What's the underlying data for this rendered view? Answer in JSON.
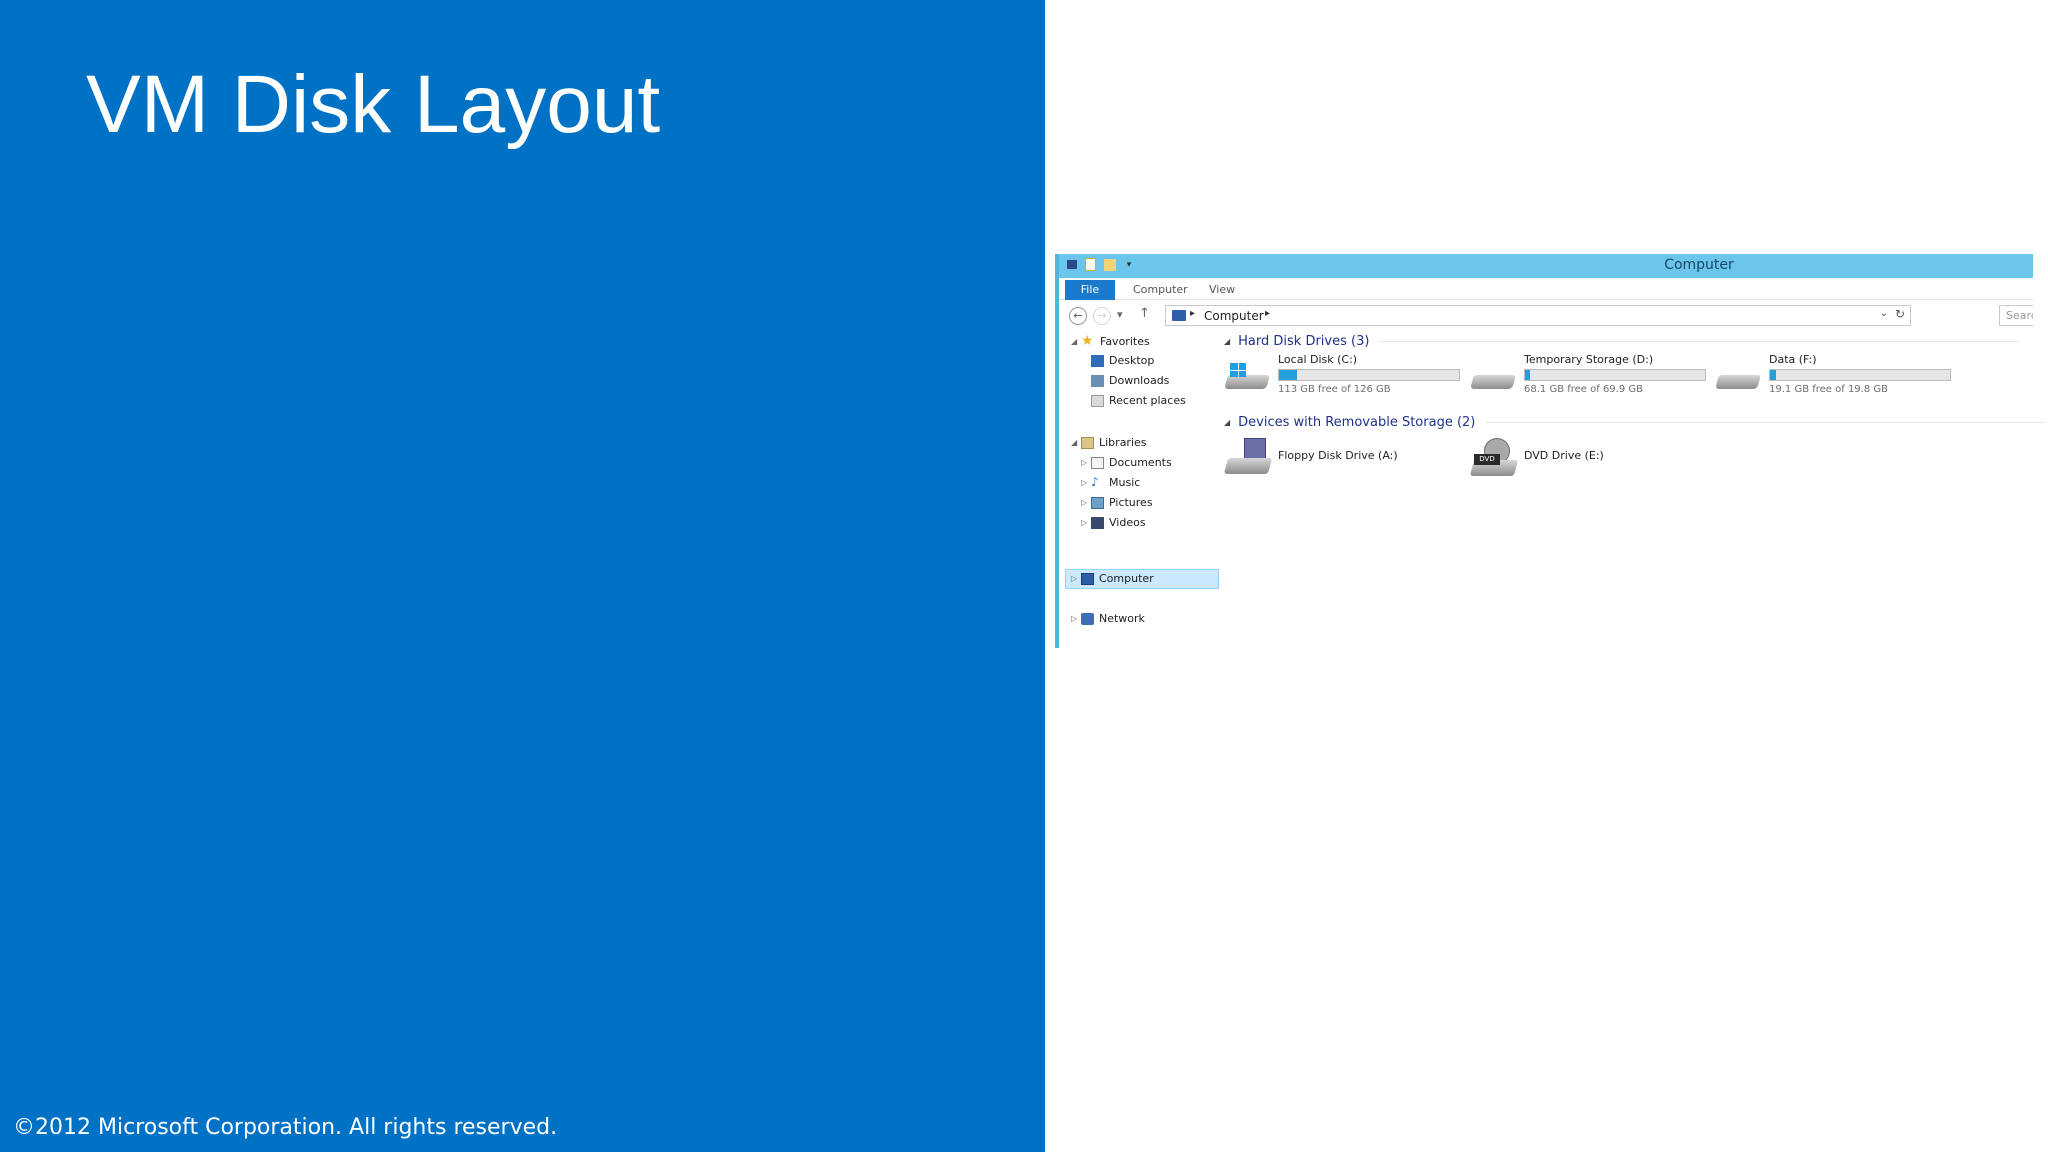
{
  "slide": {
    "title": "VM Disk Layout",
    "copyright": "©2012 Microsoft Corporation. All rights reserved.",
    "background_color": "#0072c6"
  },
  "window": {
    "title": "Computer",
    "title_bar_color": "#6cc5ea",
    "tabs": [
      "File",
      "Computer",
      "View"
    ],
    "address": {
      "path": "Computer",
      "search_placeholder": "Searc"
    }
  },
  "nav": {
    "favorites": {
      "label": "Favorites",
      "items": [
        "Desktop",
        "Downloads",
        "Recent places"
      ]
    },
    "libraries": {
      "label": "Libraries",
      "items": [
        "Documents",
        "Music",
        "Pictures",
        "Videos"
      ]
    },
    "computer": "Computer",
    "network": "Network"
  },
  "content": {
    "hard_disk_header": "Hard Disk Drives (3)",
    "removable_header": "Devices with Removable Storage (2)",
    "drives": [
      {
        "name": "Local Disk (C:)",
        "free": "113 GB free of 126 GB",
        "used_fraction": 0.1,
        "icon": "windows-drive-icon"
      },
      {
        "name": "Temporary Storage (D:)",
        "free": "68.1 GB free of 69.9 GB",
        "used_fraction": 0.026,
        "icon": "hard-drive-icon"
      },
      {
        "name": "Data (F:)",
        "free": "19.1 GB free of 19.8 GB",
        "used_fraction": 0.035,
        "icon": "hard-drive-icon"
      }
    ],
    "removable": [
      {
        "name": "Floppy Disk Drive (A:)",
        "icon": "floppy-drive-icon"
      },
      {
        "name": "DVD Drive (E:)",
        "icon": "dvd-drive-icon",
        "badge": "DVD"
      }
    ]
  }
}
